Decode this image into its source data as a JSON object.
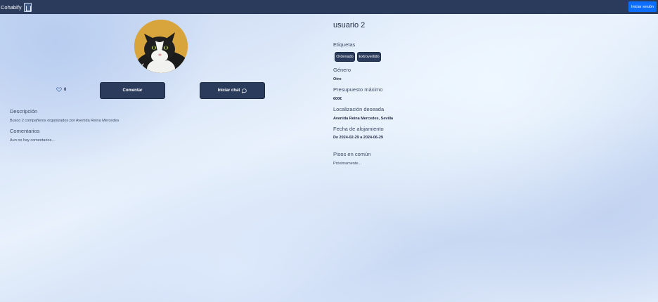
{
  "navbar": {
    "brand": "Cohabify",
    "login_label": "Iniciar sesión",
    "brand_color": "#2a3b5c",
    "accent_color": "#0d6efd"
  },
  "profile": {
    "avatar_icon": "cat-photo",
    "likes_icon": "heart-icon",
    "likes_count": "0",
    "comment_label": "Comentar",
    "chat_label": "Iniciar chat",
    "chat_icon": "chat-bubble-icon"
  },
  "left": {
    "description_title": "Descripción",
    "description_text": "Busco 2 compañeros organizados por Avenida Reina Mercedes",
    "comments_title": "Comentarios",
    "comments_empty": "Aun no hay comentarios..."
  },
  "right": {
    "username": "usuario 2",
    "tags_title": "Etiquetas",
    "tags": [
      "Ordenado",
      "Extrovertido"
    ],
    "gender_title": "Género",
    "gender_value": "Otro",
    "budget_title": "Presupuesto máximo",
    "budget_value": "600€",
    "location_title": "Localización deseada",
    "location_value": "Avenida Reina Mercedes, Sevilla",
    "dates_title": "Fecha de alojamiento",
    "dates_value": "De 2024-02-29 a 2024-06-29",
    "common_title": "Pisos en común",
    "common_value": "Próximamente..."
  }
}
